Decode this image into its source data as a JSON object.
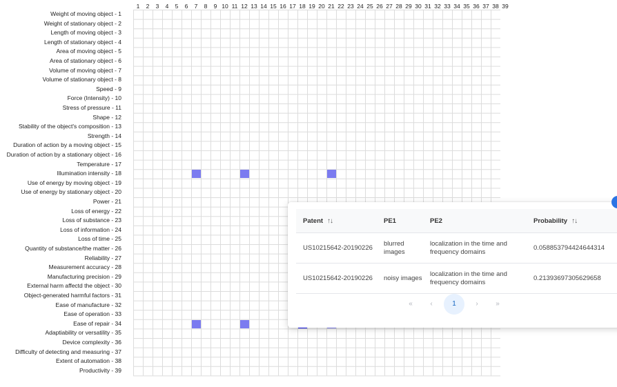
{
  "matrix": {
    "columns": [
      "1",
      "2",
      "3",
      "4",
      "5",
      "6",
      "7",
      "8",
      "9",
      "10",
      "11",
      "12",
      "13",
      "14",
      "15",
      "16",
      "17",
      "18",
      "19",
      "20",
      "21",
      "22",
      "23",
      "24",
      "25",
      "26",
      "27",
      "28",
      "29",
      "30",
      "31",
      "32",
      "33",
      "34",
      "35",
      "36",
      "37",
      "38",
      "39"
    ],
    "rows": [
      "Weight of moving object - 1",
      "Weight of stationary object - 2",
      "Length of moving object - 3",
      "Length of stationary object - 4",
      "Area of moving object - 5",
      "Area of stationary object - 6",
      "Volume of moving object - 7",
      "Volume of stationary object - 8",
      "Speed - 9",
      "Force (Intensity) - 10",
      "Stress of pressure - 11",
      "Shape - 12",
      "Stability of the object's composition - 13",
      "Strength - 14",
      "Duration of action by a moving object - 15",
      "Duration of action by a stationary object - 16",
      "Temperature - 17",
      "Illumination intensity - 18",
      "Use of energy by moving object - 19",
      "Use of energy by stationary object - 20",
      "Power - 21",
      "Loss of energy - 22",
      "Loss of substance - 23",
      "Loss of information - 24",
      "Loss of time - 25",
      "Quantity of substance/the matter - 26",
      "Reliability - 27",
      "Measurement accuracy - 28",
      "Manufacturing precision - 29",
      "External harm affectd the object - 30",
      "Object-generated harmful factors - 31",
      "Ease of manufacture - 32",
      "Ease of operation - 33",
      "Ease of repair - 34",
      "Adaptiability or versatility - 35",
      "Device complexity - 36",
      "Difficulty of detecting and measuring - 37",
      "Extent of automation - 38",
      "Productivity - 39"
    ],
    "marked_cells": [
      {
        "row": 18,
        "col": 7
      },
      {
        "row": 18,
        "col": 12
      },
      {
        "row": 18,
        "col": 21
      },
      {
        "row": 34,
        "col": 7
      },
      {
        "row": 34,
        "col": 12
      },
      {
        "row": 34,
        "col": 21
      }
    ],
    "selected_cell": {
      "row": 34,
      "col": 18
    },
    "colors": {
      "marked": "#7b7bf0",
      "selected": "#0000ee",
      "grid": "#dcdcdc"
    }
  },
  "popup": {
    "headers": {
      "patent": "Patent",
      "pe1": "PE1",
      "pe2": "PE2",
      "probability": "Probability"
    },
    "sort_icon": "sort-arrows-icon",
    "rows": [
      {
        "patent": "US10215642-20190226",
        "pe1": "blurred images",
        "pe2": "localization in the time and frequency domains",
        "probability": "0.058853794424644314"
      },
      {
        "patent": "US10215642-20190226",
        "pe1": "noisy images",
        "pe2": "localization in the time and frequency domains",
        "probability": "0.21393697305629658"
      }
    ],
    "pagination": {
      "first": "«",
      "prev": "‹",
      "current": "1",
      "next": "›",
      "last": "»"
    }
  }
}
